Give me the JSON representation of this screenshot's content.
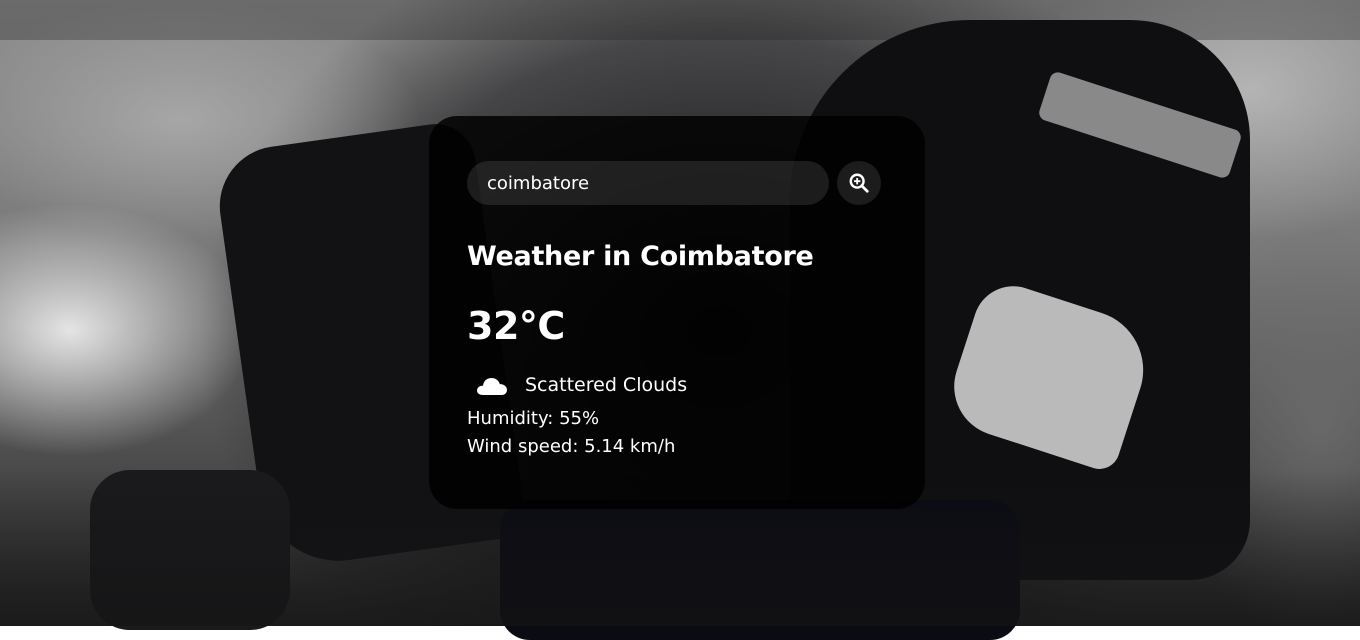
{
  "search": {
    "value": "coimbatore",
    "button_icon": "search-icon"
  },
  "weather": {
    "city_title": "Weather in Coimbatore",
    "temperature": "32°C",
    "icon": "cloud-icon",
    "description": "Scattered Clouds",
    "humidity": "Humidity: 55%",
    "wind": "Wind speed: 5.14 km/h"
  },
  "colors": {
    "card_background": "#000000",
    "text": "#ffffff",
    "input_background": "#7c7c7c"
  }
}
